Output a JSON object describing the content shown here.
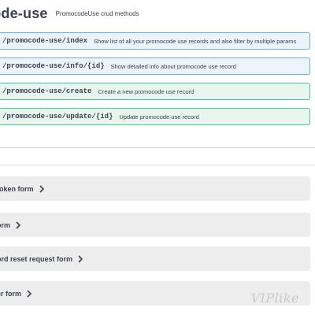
{
  "section": {
    "title": "code-use",
    "description": "PromocodeUse crud methods"
  },
  "operations": [
    {
      "method": "get",
      "path": "/promocode-use/index",
      "summary": "Show list of all your promocode use records and also filter by multiple params"
    },
    {
      "method": "get",
      "path": "/promocode-use/info/{id}",
      "summary": "Show detailed info about promocode use record"
    },
    {
      "method": "post",
      "path": "/promocode-use/create",
      "summary": "Create a new promocode use record"
    },
    {
      "method": "post",
      "path": "/promocode-use/update/{id}",
      "summary": "Update promocode use record"
    }
  ],
  "models": [
    {
      "label": "token form"
    },
    {
      "label": "orm"
    },
    {
      "label": "ord reset request form"
    },
    {
      "label": "er form"
    }
  ],
  "watermark": "VIPlike",
  "colors": {
    "get_bg": "#ebf3fb",
    "get_border": "#61affe",
    "post_bg": "#e8f6f0",
    "post_border": "#49cc90",
    "model_bg": "#ededed",
    "text": "#3b4151"
  },
  "icons": {
    "model_expand": "chevron-right-icon"
  }
}
